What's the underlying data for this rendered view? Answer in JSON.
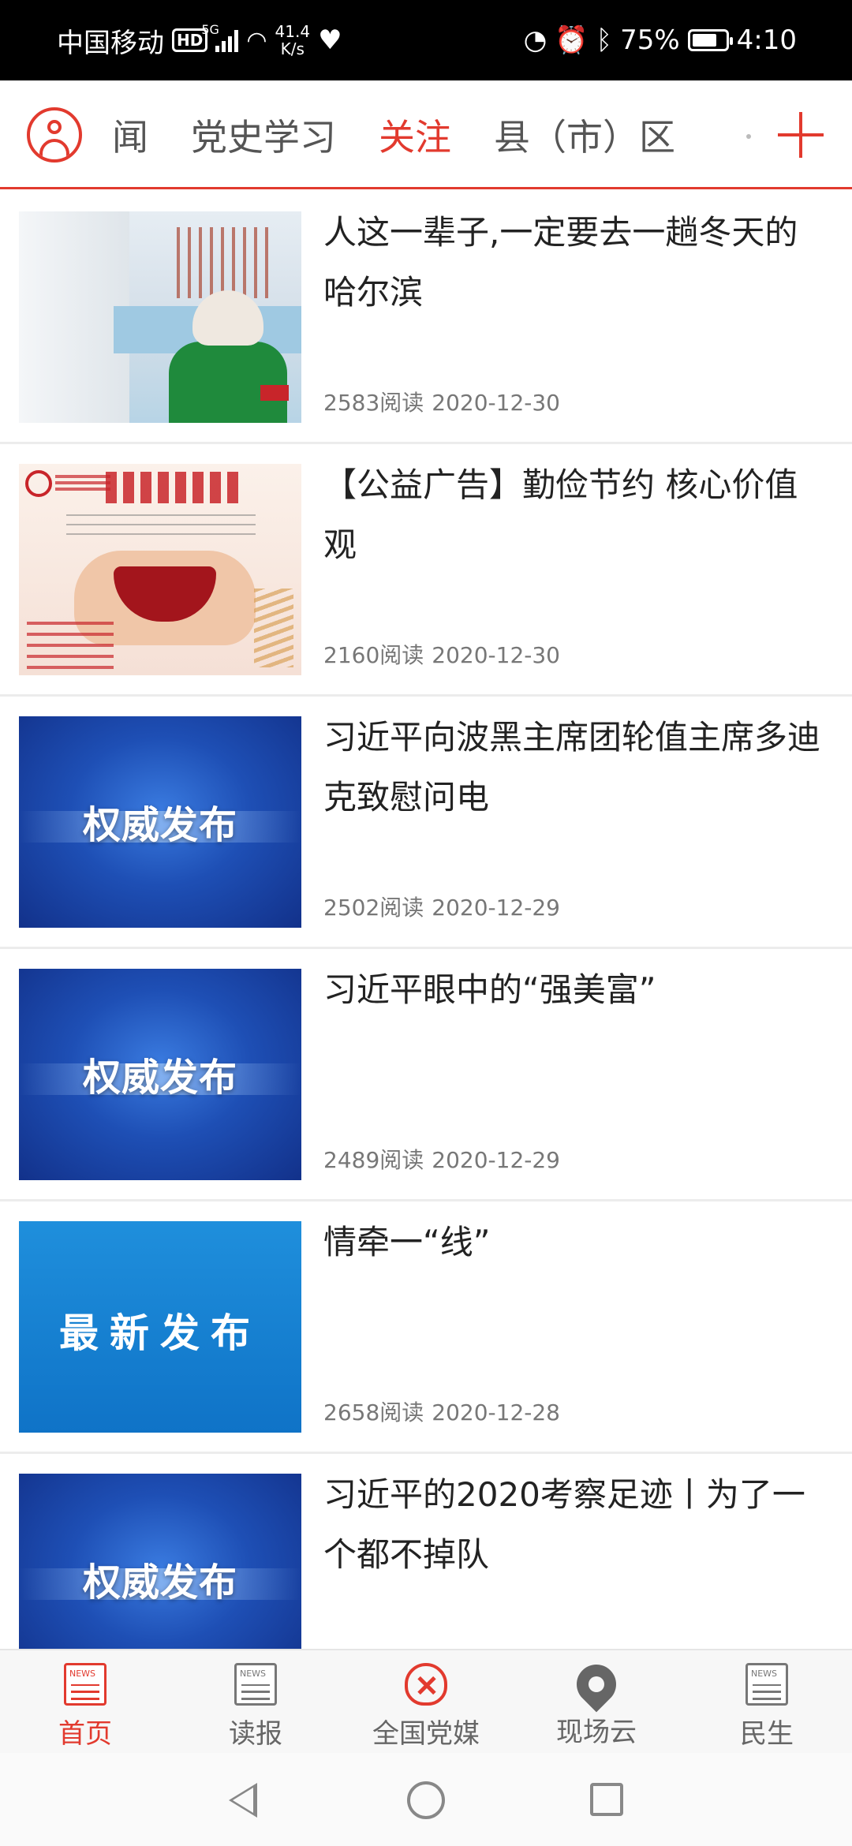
{
  "status_bar": {
    "carrier": "中国移动",
    "hd": "HD",
    "network": "5G",
    "speed_value": "41.4",
    "speed_unit": "K/s",
    "battery_percent": "75%",
    "battery_level": 0.75,
    "time": "4:10"
  },
  "channel_bar": {
    "tabs": [
      "闻",
      "党史学习",
      "关注",
      "县（市）区"
    ],
    "active_tab": "关注",
    "accent_color": "#e23a2e"
  },
  "articles": [
    {
      "title": "人这一辈子,一定要去一趟冬天的哈尔滨",
      "reads": "2583阅读",
      "date": "2020-12-30",
      "thumb": "winter-scene"
    },
    {
      "title": "【公益广告】勤俭节约 核心价值观",
      "reads": "2160阅读",
      "date": "2020-12-30",
      "thumb": "frugal-poster"
    },
    {
      "title": "习近平向波黑主席团轮值主席多迪克致慰问电",
      "reads": "2502阅读",
      "date": "2020-12-29",
      "thumb": "authoritative-release",
      "thumb_text": "权威发布"
    },
    {
      "title": "习近平眼中的“强美富”",
      "reads": "2489阅读",
      "date": "2020-12-29",
      "thumb": "authoritative-release",
      "thumb_text": "权威发布"
    },
    {
      "title": "情牵一“线”",
      "reads": "2658阅读",
      "date": "2020-12-28",
      "thumb": "latest-release",
      "thumb_text": "最新发布"
    },
    {
      "title": "习近平的2020考察足迹丨为了一个都不掉队",
      "reads": "",
      "date": "",
      "thumb": "authoritative-release",
      "thumb_text": "权威发布"
    }
  ],
  "bottom_nav": [
    {
      "label": "首页",
      "icon": "news-icon",
      "active": true
    },
    {
      "label": "读报",
      "icon": "news-icon",
      "active": false
    },
    {
      "label": "全国党媒",
      "icon": "party-emblem-icon",
      "active": false
    },
    {
      "label": "现场云",
      "icon": "location-pin-icon",
      "active": false
    },
    {
      "label": "民生",
      "icon": "news-icon",
      "active": false
    }
  ]
}
